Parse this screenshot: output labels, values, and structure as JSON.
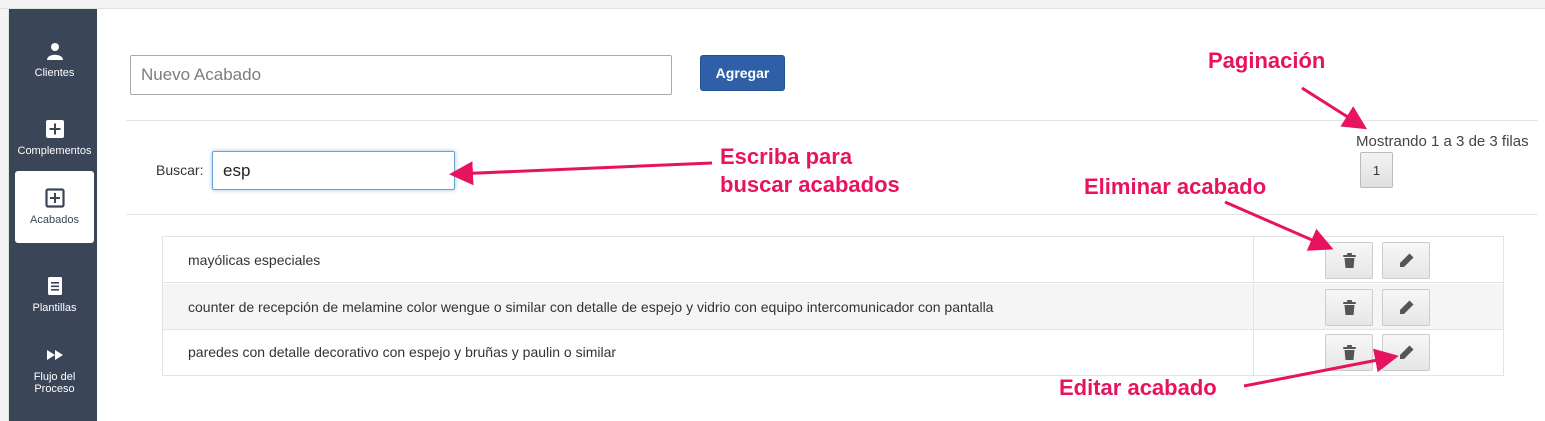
{
  "sidebar": {
    "items": [
      {
        "label": "Clientes",
        "icon": "user-icon"
      },
      {
        "label": "Complementos",
        "icon": "plus-square-icon"
      },
      {
        "label": "Acabados",
        "icon": "plus-square-outline-icon",
        "active": true
      },
      {
        "label": "Plantillas",
        "icon": "document-icon"
      },
      {
        "label": "Flujo del Proceso",
        "icon": "fast-forward-icon"
      }
    ]
  },
  "new_finish": {
    "placeholder": "Nuevo Acabado",
    "button_label": "Agregar"
  },
  "search": {
    "label": "Buscar:",
    "value": "esp"
  },
  "pagination": {
    "info": "Mostrando 1 a 3 de 3 filas",
    "current_page": "1"
  },
  "table": {
    "rows": [
      {
        "text": "mayólicas especiales"
      },
      {
        "text": "counter de recepción de melamine color wengue o similar con detalle de espejo y vidrio con equipo intercomunicador con pantalla"
      },
      {
        "text": "paredes con detalle decorativo con espejo y bruñas y paulin o similar"
      }
    ],
    "actions": [
      "trash-icon",
      "pencil-icon"
    ]
  },
  "annotations": {
    "pagination": "Paginación",
    "search_line1": "Escriba para",
    "search_line2": "buscar acabados",
    "delete": "Eliminar acabado",
    "edit": "Editar acabado"
  },
  "colors": {
    "sidebar_bg": "#3b4558",
    "primary_button": "#2f5fa7",
    "annotation": "#e8135f"
  }
}
